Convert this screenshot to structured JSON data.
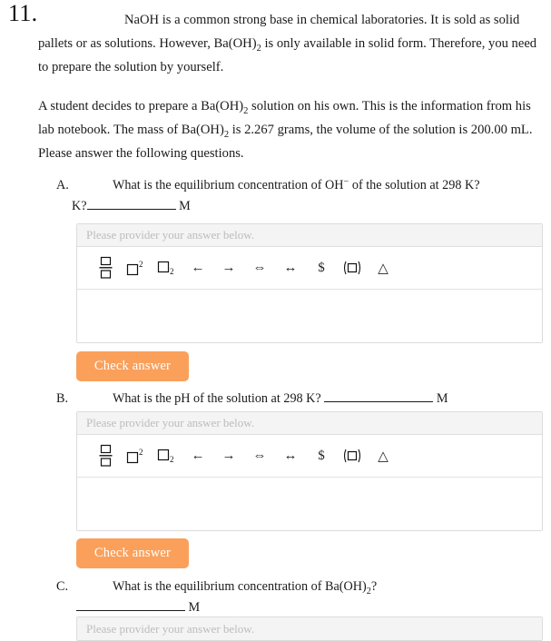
{
  "document": {
    "problem_number": "11.",
    "paragraph_1_parts": {
      "a": "NaOH is a common strong base in chemical laboratories. It is sold as solid pallets or as solutions. However, Ba(OH)",
      "sub": "2",
      "b": " is only available in solid form. Therefore, you need to prepare the solution by yourself."
    },
    "paragraph_2_parts": {
      "a": "A student decides to prepare a Ba(OH)",
      "sub1": "2",
      "b": " solution on his own. This is the information from his lab notebook. The mass of Ba(OH)",
      "sub2": "2",
      "c": " is 2.267 grams, the volume of the solution is 200.00 mL. Please answer the following questions."
    }
  },
  "questions": [
    {
      "label": "A.",
      "text_before": "What is the equilibrium concentration of OH",
      "superscript": "−",
      "text_after": " of the solution at 298 K?",
      "line_two_prefix": "K?",
      "unit": "M",
      "has_editor": true,
      "has_check_button": true,
      "check_label": "Check answer"
    },
    {
      "label": "B.",
      "text": "What is the pH of the solution at 298 K?",
      "unit": "M",
      "has_editor": true,
      "has_check_button": true,
      "check_label": "Check answer"
    },
    {
      "label": "C.",
      "text_before": "What is the equilibrium concentration of Ba(OH)",
      "subscript": "2",
      "text_after": "?",
      "unit": "M",
      "has_editor": true,
      "has_check_button": false,
      "check_label": "Check answer"
    }
  ],
  "editor": {
    "placeholder": "Please provider your answer below.",
    "toolbar": [
      {
        "name": "fraction-icon",
        "title": "Fraction"
      },
      {
        "name": "superscript-icon",
        "title": "Superscript"
      },
      {
        "name": "subscript-icon",
        "title": "Subscript"
      },
      {
        "name": "arrow-left-icon",
        "title": "Left arrow",
        "glyph": "←"
      },
      {
        "name": "arrow-right-icon",
        "title": "Right arrow",
        "glyph": "→"
      },
      {
        "name": "double-arrow-icon",
        "title": "Equilibrium arrow",
        "glyph": "⇔"
      },
      {
        "name": "left-right-arrow-icon",
        "title": "Left-right arrow",
        "glyph": "↔"
      },
      {
        "name": "dollar-s-icon",
        "title": "S",
        "glyph": "$"
      },
      {
        "name": "parenthesis-box-icon",
        "title": "Parentheses"
      },
      {
        "name": "delta-triangle-icon",
        "title": "Delta",
        "glyph": "△"
      }
    ]
  },
  "colors": {
    "button_orange": "#faa05b",
    "button_text": "#ffffff",
    "editor_border": "#dcdcdc",
    "editor_header_bg": "#f4f4f4",
    "placeholder_text": "#bcbcbc",
    "body_text": "#1a1a1a"
  }
}
